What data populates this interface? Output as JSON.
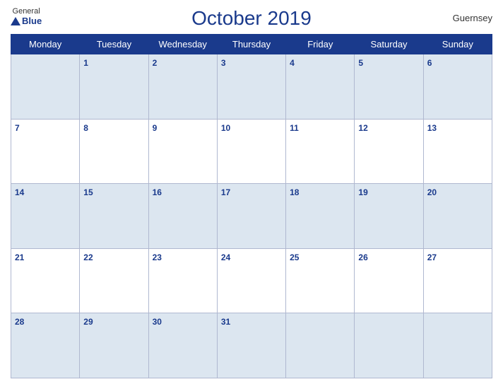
{
  "header": {
    "logo_general": "General",
    "logo_blue": "Blue",
    "title": "October 2019",
    "country": "Guernsey"
  },
  "days_of_week": [
    "Monday",
    "Tuesday",
    "Wednesday",
    "Thursday",
    "Friday",
    "Saturday",
    "Sunday"
  ],
  "weeks": [
    [
      null,
      1,
      2,
      3,
      4,
      5,
      6
    ],
    [
      7,
      8,
      9,
      10,
      11,
      12,
      13
    ],
    [
      14,
      15,
      16,
      17,
      18,
      19,
      20
    ],
    [
      21,
      22,
      23,
      24,
      25,
      26,
      27
    ],
    [
      28,
      29,
      30,
      31,
      null,
      null,
      null
    ]
  ]
}
